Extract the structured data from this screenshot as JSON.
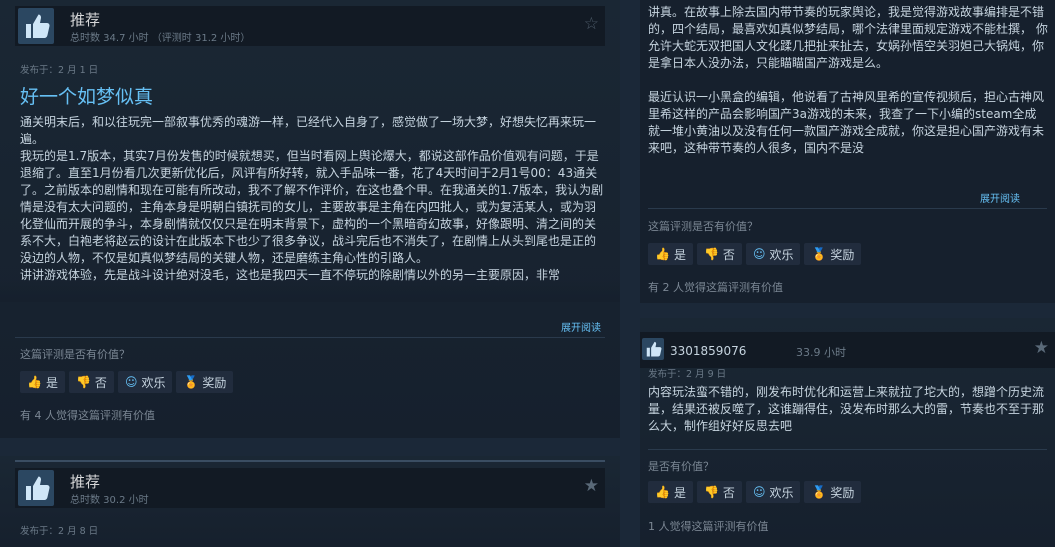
{
  "left": {
    "review1": {
      "verdict": "推荐",
      "hours": "总时数 34.7 小时 （评测时 31.2 小时）",
      "posted": "发布于：2 月 1 日",
      "title": "好一个如梦似真",
      "paragraphs": [
        "通关明末后，和以往玩完一部叙事优秀的魂游一样，已经代入自身了，感觉做了一场大梦，好想失忆再来玩一遍。",
        "我玩的是1.7版本，其实7月份发售的时候就想买，但当时看网上舆论爆大，都说这部作品价值观有问题，于是退缩了。直至1月份看几次更新优化后，风评有所好转，就入手品味一番，花了4天时间于2月1号00：43通关了。之前版本的剧情和现在可能有所改动，我不了解不作评价，在这也叠个甲。在我通关的1.7版本，我认为剧情是没有太大问题的，主角本身是明朝白镇抚司的女儿，主要故事是主角在内四批人，或为复活某人，或为羽化登仙而开展的争斗，本身剧情就仅仅只是在明末背景下，虚构的一个黑暗奇幻故事，好像跟明、清之间的关系不大，白袍老将赵云的设计在此版本下也少了很多争议，战斗完后也不消失了，在剧情上从头到尾也是正的没边的人物，不仅是如真似梦结局的关键人物，还是磨练主角心性的引路人。",
        "讲讲游戏体验，先是战斗设计绝对没毛，这也是我四天一直不停玩的除剧情以外的另一主要原因，非常"
      ],
      "expand": "展开阅读",
      "helpful_q": "这篇评测是否有价值？",
      "buttons": {
        "yes": "是",
        "no": "否",
        "funny": "欢乐",
        "award": "奖励"
      },
      "count": "有 4 人觉得这篇评测有价值"
    },
    "review2": {
      "verdict": "推荐",
      "hours": "总时数 30.2 小时",
      "posted": "发布于：2 月 8 日"
    }
  },
  "right": {
    "review1": {
      "paragraph1": "讲真。在故事上除去国内带节奏的玩家舆论，我是觉得游戏故事编排是不错的，四个结局，最喜欢如真似梦结局，哪个法律里面规定游戏不能杜撰， 你允许大蛇无双把国人文化蹂几把扯来扯去，女娲孙悟空关羽妲己大锅炖，你是拿日本人没办法，只能瞄瞄国产游戏是么。",
      "paragraph2": "最近认识一小黑盒的编辑，他说看了古神风里希的宣传视频后，担心古神风里希这样的产品会影响国产3a游戏的未来，我查了一下小编的steam全成就一堆小黄油以及没有任何一款国产游戏全成就，你这是担心国产游戏有未来吧，这种带节奏的人很多，国内不是没",
      "expand": "展开阅读",
      "helpful_q": "这篇评测是否有价值？",
      "buttons": {
        "yes": "是",
        "no": "否",
        "funny": "欢乐",
        "award": "奖励"
      },
      "count": "有 2 人觉得这篇评测有价值"
    },
    "review2": {
      "username": "3301859076",
      "hours": "33.9 小时",
      "posted": "发布于：2 月 9 日",
      "body": "内容玩法蛮不错的，刚发布时优化和运营上来就拉了坨大的，想蹭个历史流量，结果还被反噬了，这谁蹦得住，没发布时那么大的雷，节奏也不至于那么大，制作组好好反思去吧",
      "helpful_q": "是否有价值？",
      "buttons": {
        "yes": "是",
        "no": "否",
        "funny": "欢乐",
        "award": "奖励"
      },
      "count": "1 人觉得这篇评测有价值"
    }
  },
  "colors": {
    "page_bg": "#1b2838",
    "card_bg": "#16202d",
    "link_blue": "#66c0f4",
    "text_main": "#c6d4df",
    "text_muted": "#7b8794",
    "award_gold": "#f5c518"
  },
  "icons": [
    "thumbs-up-icon",
    "thumbs-down-icon",
    "smiley-icon",
    "award-icon",
    "star-icon"
  ]
}
